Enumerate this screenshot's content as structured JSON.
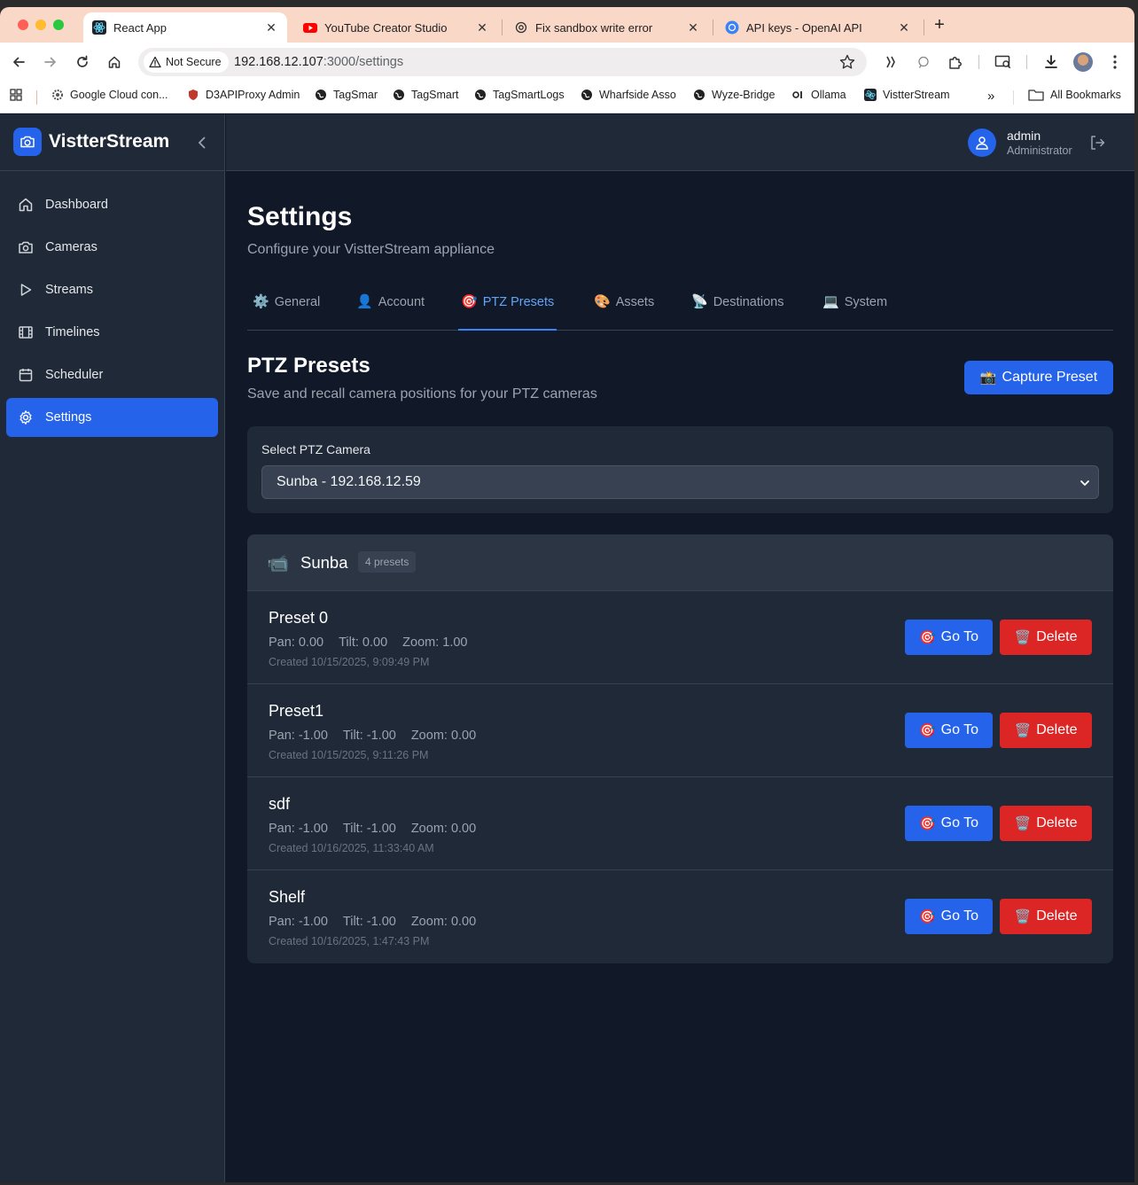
{
  "browser": {
    "tabs": [
      {
        "title": "React App",
        "active": true
      },
      {
        "title": "YouTube Creator Studio"
      },
      {
        "title": "Fix sandbox write error"
      },
      {
        "title": "API keys - OpenAI API"
      }
    ],
    "security_label": "Not Secure",
    "url_host": "192.168.12.107",
    "url_path": ":3000/settings",
    "bookmarks": [
      "Google Cloud con...",
      "D3APIProxy Admin",
      "TagSmar",
      "TagSmart",
      "TagSmartLogs",
      "Wharfside Asso",
      "Wyze-Bridge",
      "Ollama",
      "VistterStream"
    ],
    "all_bookmarks": "All Bookmarks",
    "more_bookmarks": "»"
  },
  "app": {
    "brand": "VistterStream",
    "nav": [
      {
        "label": "Dashboard",
        "icon": "home-icon"
      },
      {
        "label": "Cameras",
        "icon": "camera-icon"
      },
      {
        "label": "Streams",
        "icon": "play-icon"
      },
      {
        "label": "Timelines",
        "icon": "film-icon"
      },
      {
        "label": "Scheduler",
        "icon": "calendar-icon"
      },
      {
        "label": "Settings",
        "icon": "gear-icon",
        "active": true
      }
    ],
    "user": {
      "name": "admin",
      "role": "Administrator"
    }
  },
  "page": {
    "title": "Settings",
    "subtitle": "Configure your VistterStream appliance",
    "tabs": [
      {
        "emoji": "⚙️",
        "label": "General"
      },
      {
        "emoji": "👤",
        "label": "Account"
      },
      {
        "emoji": "🎯",
        "label": "PTZ Presets",
        "active": true
      },
      {
        "emoji": "🎨",
        "label": "Assets"
      },
      {
        "emoji": "📡",
        "label": "Destinations"
      },
      {
        "emoji": "💻",
        "label": "System"
      }
    ]
  },
  "ptz": {
    "title": "PTZ Presets",
    "subtitle": "Save and recall camera positions for your PTZ cameras",
    "capture_label": "Capture Preset",
    "capture_emoji": "📸",
    "select_label": "Select PTZ Camera",
    "selected_camera": "Sunba - 192.168.12.59",
    "camera_emoji": "📹",
    "camera_name": "Sunba",
    "preset_count": "4 presets",
    "goto_emoji": "🎯",
    "goto_label": "Go To",
    "delete_emoji": "🗑️",
    "delete_label": "Delete",
    "presets": [
      {
        "name": "Preset 0",
        "pan": "Pan: 0.00",
        "tilt": "Tilt: 0.00",
        "zoom": "Zoom: 1.00",
        "created": "Created 10/15/2025, 9:09:49 PM"
      },
      {
        "name": "Preset1",
        "pan": "Pan: -1.00",
        "tilt": "Tilt: -1.00",
        "zoom": "Zoom: 0.00",
        "created": "Created 10/15/2025, 9:11:26 PM"
      },
      {
        "name": "sdf",
        "pan": "Pan: -1.00",
        "tilt": "Tilt: -1.00",
        "zoom": "Zoom: 0.00",
        "created": "Created 10/16/2025, 11:33:40 AM"
      },
      {
        "name": "Shelf",
        "pan": "Pan: -1.00",
        "tilt": "Tilt: -1.00",
        "zoom": "Zoom: 0.00",
        "created": "Created 10/16/2025, 1:47:43 PM"
      }
    ]
  },
  "colors": {
    "accent": "#2563eb",
    "danger": "#dc2626",
    "background": "#111827",
    "panel": "#1f2937"
  }
}
